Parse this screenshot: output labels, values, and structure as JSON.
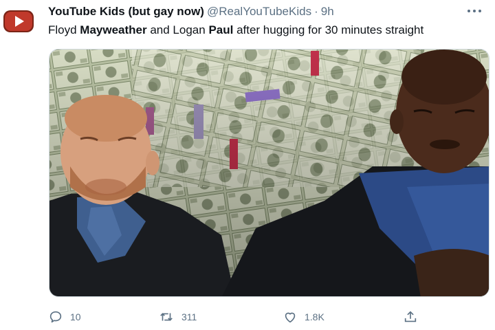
{
  "tweet": {
    "display_name": "YouTube Kids (but gay now)",
    "handle": "@RealYouTubeKids",
    "separator": "·",
    "time": "9h",
    "text_parts": {
      "p1": "Floyd ",
      "b1": "Mayweather",
      "p2": " and Logan ",
      "b2": "Paul",
      "p3": " after hugging for 30 minutes straight"
    }
  },
  "actions": {
    "reply_count": "10",
    "retweet_count": "311",
    "like_count": "1.8K"
  },
  "icons": {
    "avatar": "youtube-kids-logo",
    "more": "more-dots-icon",
    "reply": "reply-icon",
    "retweet": "retweet-icon",
    "like": "heart-icon",
    "share": "share-icon"
  },
  "colors": {
    "text_primary": "#0f1419",
    "text_secondary": "#5b7083",
    "brand_red": "#e03a2f"
  }
}
